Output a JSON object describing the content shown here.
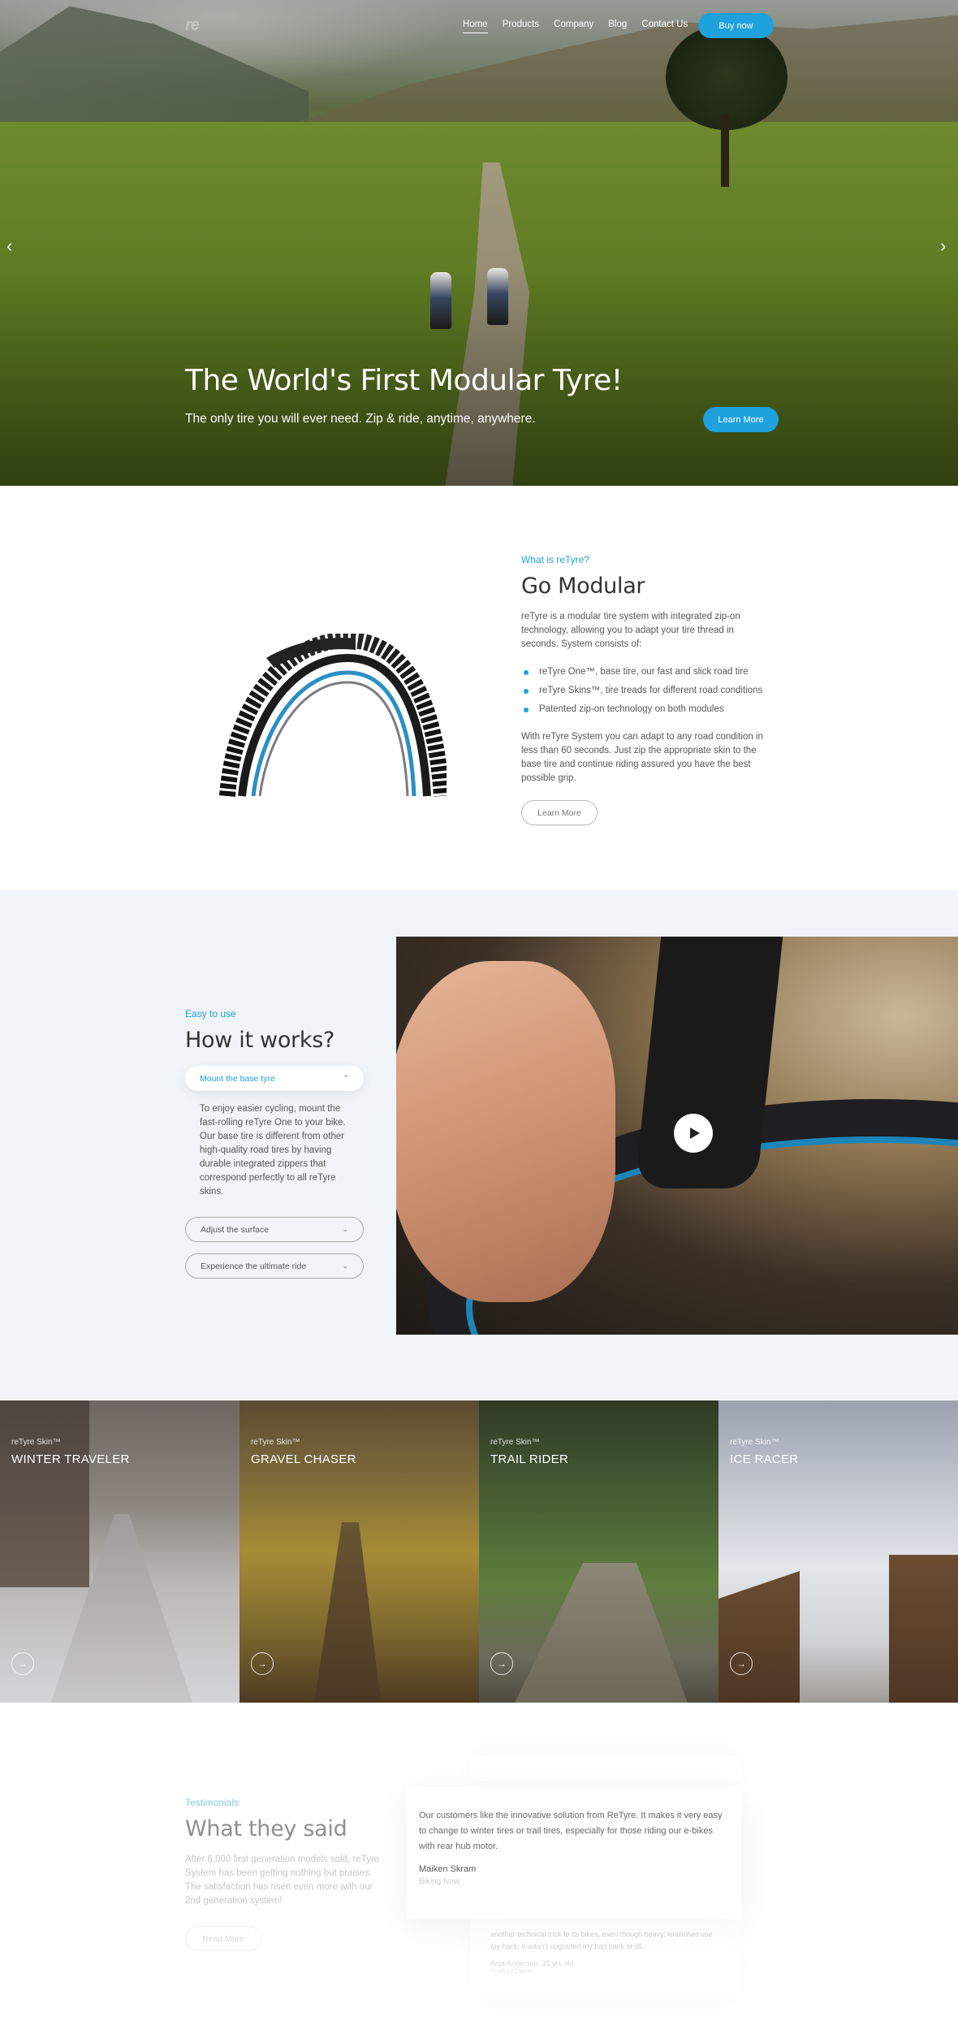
{
  "header": {
    "logo": "re",
    "nav": [
      "Home",
      "Products",
      "Company",
      "Blog",
      "Contact Us"
    ],
    "buy_label": "Buy now"
  },
  "hero": {
    "title": "The World's First Modular Tyre!",
    "subtitle": "The only tire you will ever need. Zip & ride, anytime, anywhere.",
    "cta_label": "Learn More",
    "prev_icon": "chevron-left-icon",
    "next_icon": "chevron-right-icon"
  },
  "modular": {
    "eyebrow": "What is reTyre?",
    "title": "Go Modular",
    "intro": "reTyre is a modular tire system with integrated zip-on technology, allowing you to adapt your tire thread in seconds. System consists of:",
    "bullets": [
      "reTyre One™, base tire, our fast and slick road tire",
      "reTyre Skins™, tire treads for different road conditions",
      "Patented zip-on technology on both modules"
    ],
    "outro": "With reTyre System you can adapt to any road condition in less than 60 seconds. Just zip the appropriate skin to the base tire and continue riding assured you have the best possible grip.",
    "cta_label": "Learn More"
  },
  "how": {
    "eyebrow": "Easy to use",
    "title": "How it works?",
    "steps": [
      {
        "label": "Mount the base tyre",
        "body": "To enjoy easier cycling, mount the fast-rolling reTyre One to your bike. Our base tire is different from other high-quality road tires by having durable integrated zippers that correspond perfectly to all reTyre skins."
      },
      {
        "label": "Adjust the surface"
      },
      {
        "label": "Experience the ultimate ride"
      }
    ]
  },
  "skins": [
    {
      "category": "reTyre Skin™",
      "name": "WINTER TRAVELER"
    },
    {
      "category": "reTyre Skin™",
      "name": "GRAVEL CHASER"
    },
    {
      "category": "reTyre Skin™",
      "name": "TRAIL RIDER"
    },
    {
      "category": "reTyre Skin™",
      "name": "ICE RACER"
    }
  ],
  "testimonials": {
    "eyebrow": "Testimonials",
    "title": "What they said",
    "body": "After 6.000 first generation models sold, reTyre System has been getting nothing but praises. The satisfaction has risen even more with our 2nd generation system!",
    "cta_label": "Read More",
    "items": [
      {
        "quote": "Our customers like the innovative solution from ReTyre. It makes it very easy to change to winter tires or trail tires, especially for those riding our e-bikes with rear hub motor.",
        "author": "Maiken Skram",
        "role": "Biking Now"
      },
      {
        "quote": "another technical trick to its bikes, even though heavy, wrenches use my back, it wasn't upgraded my bad back at all.",
        "author": "Anja Andersen, 35 yrs old",
        "role": "Product Owner"
      }
    ]
  },
  "colors": {
    "accent": "#1ea1dd",
    "section_bg": "#f1f4f8"
  }
}
